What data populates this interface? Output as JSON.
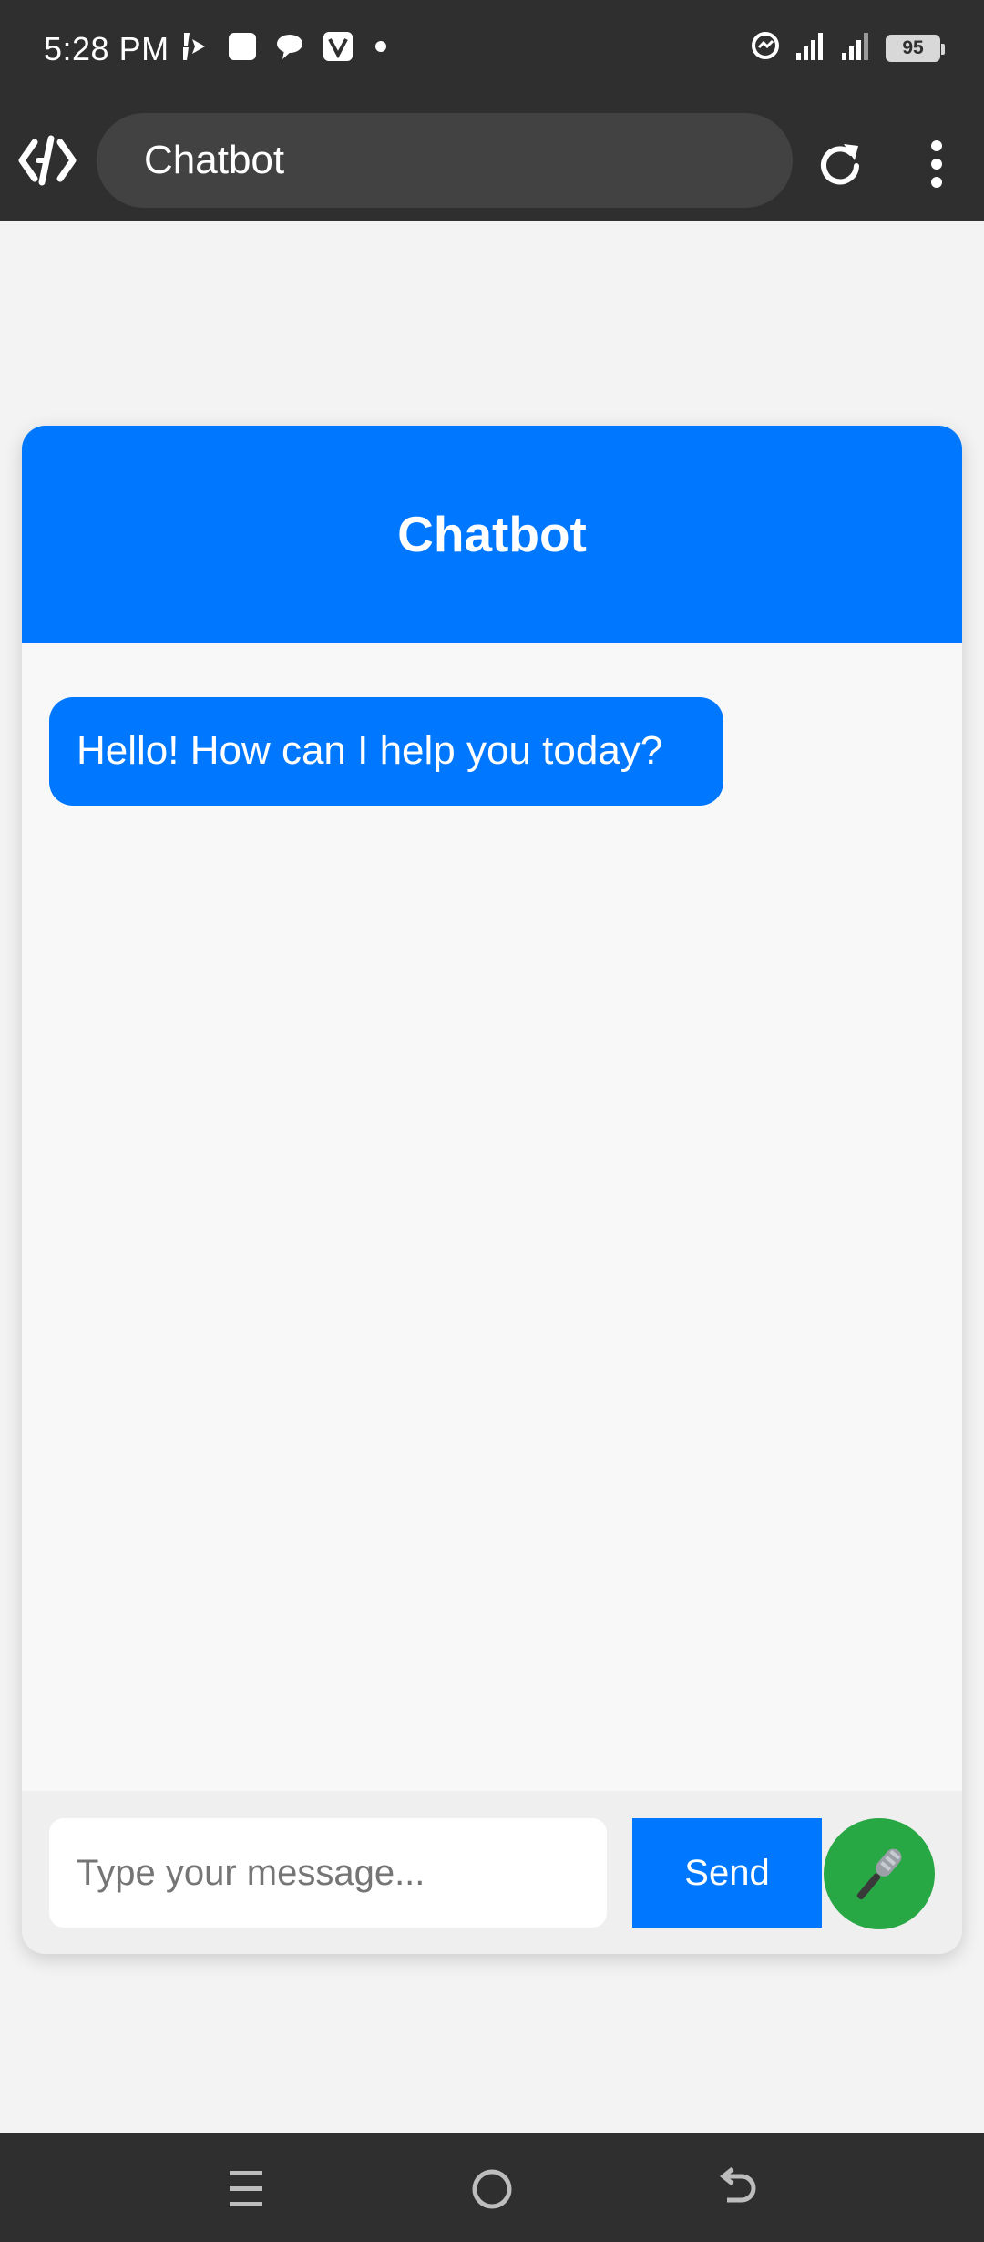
{
  "status_bar": {
    "time": "5:28 PM",
    "battery": "95",
    "left_icons": [
      "bolt-app-icon",
      "square-notification-icon",
      "chat-bubble-icon",
      "v-app-icon",
      "dot-icon"
    ],
    "right_icons": [
      "data-saver-icon",
      "signal-1-icon",
      "signal-2-icon",
      "battery-icon"
    ]
  },
  "browser": {
    "url_text": "Chatbot",
    "logo_icon": "code-brackets-logo-icon",
    "reload_icon": "reload-icon",
    "menu_icon": "more-vertical-icon"
  },
  "chat": {
    "header_title": "Chatbot",
    "messages": [
      {
        "sender": "bot",
        "text": "Hello! How can I help you today?"
      }
    ],
    "input_placeholder": "Type your message...",
    "send_label": "Send",
    "mic_icon": "microphone-icon"
  },
  "nav_bar": {
    "icons": [
      "menu-lines-icon",
      "home-circle-icon",
      "back-arrow-icon"
    ]
  },
  "colors": {
    "system_bar": "#2f2f2f",
    "url_pill": "#424242",
    "accent_blue": "#0077ff",
    "mic_green": "#28a745",
    "card_bg": "#f8f8f8",
    "page_bg": "#f3f3f3"
  }
}
